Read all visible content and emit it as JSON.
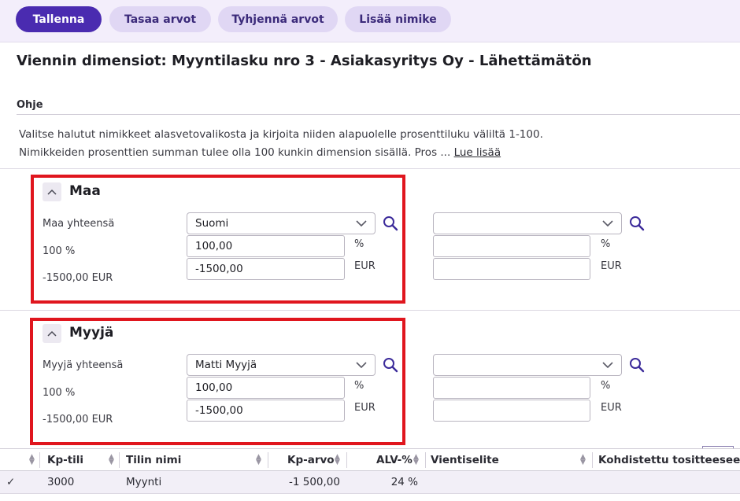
{
  "toolbar": {
    "save_label": "Tallenna",
    "balance_label": "Tasaa arvot",
    "clear_label": "Tyhjennä arvot",
    "add_label": "Lisää nimike"
  },
  "page": {
    "title": "Viennin dimensiot: Myyntilasku nro 3 - Asiakasyritys Oy - Lähettämätön"
  },
  "help": {
    "label": "Ohje",
    "line1": "Valitse halutut nimikkeet alasvetovalikosta ja kirjoita niiden alapuolelle prosenttiluku väliltä 1-100.",
    "line2": "Nimikkeiden prosenttien summan tulee olla 100 kunkin dimension sisällä. Pros ...",
    "read_more": "Lue lisää"
  },
  "dimensions": [
    {
      "title": "Maa",
      "total_label": "Maa yhteensä",
      "percent_total": "100 %",
      "amount_total": "-1500,00 EUR",
      "item1": {
        "selected": "Suomi",
        "percent": "100,00",
        "amount": "-1500,00"
      },
      "item2": {
        "selected": "",
        "percent": "",
        "amount": ""
      },
      "percent_unit": "%",
      "currency_unit": "EUR"
    },
    {
      "title": "Myyjä",
      "total_label": "Myyjä yhteensä",
      "percent_total": "100 %",
      "amount_total": "-1500,00 EUR",
      "item1": {
        "selected": "Matti Myyjä",
        "percent": "100,00",
        "amount": "-1500,00"
      },
      "item2": {
        "selected": "",
        "percent": "",
        "amount": ""
      },
      "percent_unit": "%",
      "currency_unit": "EUR"
    }
  ],
  "grid": {
    "columns": [
      "Kp-tili",
      "Tilin nimi",
      "Kp-arvo",
      "ALV-%",
      "Vientiselite",
      "Kohdistettu tositteeseen"
    ],
    "rows": [
      {
        "check": "✓",
        "account": "3000",
        "name": "Myynti",
        "amount": "-1 500,00",
        "vat": "24 %",
        "description": "",
        "allocated": ""
      }
    ]
  },
  "colors": {
    "primary": "#4a2bb0",
    "secondary": "#e0d7f4",
    "highlight_border": "#e0161e",
    "search_icon": "#3b2a9a"
  },
  "icons": [
    "chevron-up-icon",
    "chevron-down-icon",
    "search-icon",
    "sort-icon",
    "checkmark-icon"
  ]
}
